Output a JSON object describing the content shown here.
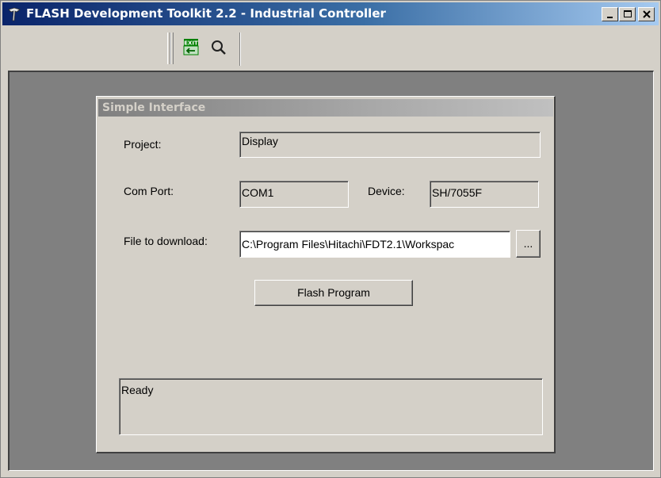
{
  "window": {
    "title": "FLASH Development Toolkit 2.2 - Industrial Controller",
    "title_bar_color": "#0a246a"
  },
  "toolbar": {
    "exit_icon_text": "EXIT",
    "buttons": [
      "exit-icon",
      "find-icon"
    ]
  },
  "simple_interface": {
    "title": "Simple Interface",
    "project_label": "Project:",
    "project_value": "Display",
    "com_port_label": "Com Port:",
    "com_port_value": "COM1",
    "device_label": "Device:",
    "device_value": "SH/7055F",
    "file_label": "File to download:",
    "file_value": "C:\\Program Files\\Hitachi\\FDT2.1\\Workspac",
    "browse_label": "...",
    "flash_button_label": "Flash Program",
    "status_text": "Ready"
  }
}
